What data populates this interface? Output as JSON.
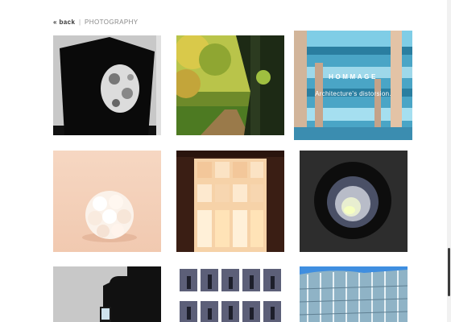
{
  "breadcrumb": {
    "back_label": "« back",
    "separator": "|",
    "section": "PHOTOGRAPHY"
  },
  "hover_tile": {
    "title": "HOMMAGE",
    "subtitle": "Architecture's distorsion."
  },
  "gallery": [
    "dark-lantern-photo",
    "forest-path-photo",
    "blue-building-photo",
    "white-spheres-photo",
    "glowing-window-photo",
    "blurred-light-photo",
    "silhouette-building-photo",
    "contact-sheet-photo",
    "glass-tower-photo"
  ],
  "colors": {
    "accent_text": "#333333",
    "muted_text": "#888888",
    "scrollbar_thumb": "#3a3a3a"
  }
}
